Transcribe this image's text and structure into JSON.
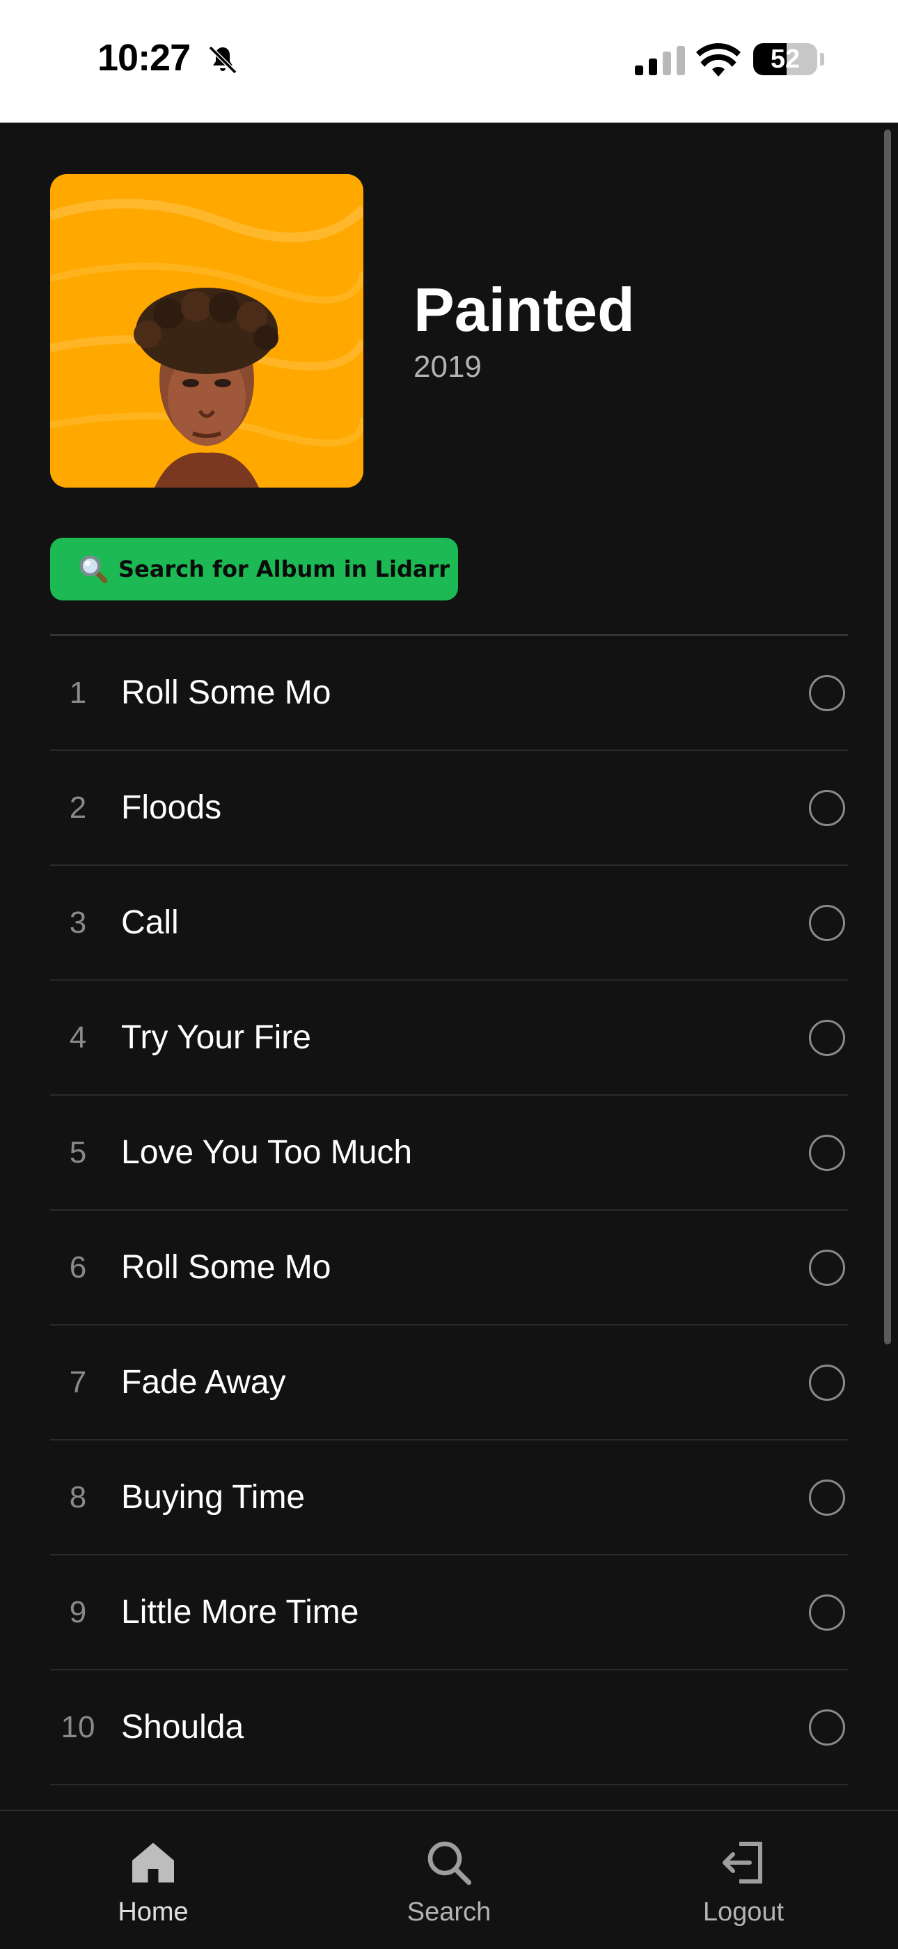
{
  "status_bar": {
    "time": "10:27",
    "battery_percent": 52,
    "battery_label": "52",
    "icons": [
      "bell-slash-icon",
      "cellular-signal-icon",
      "wifi-icon",
      "battery-icon"
    ]
  },
  "album": {
    "title": "Painted",
    "year": "2019",
    "cover_color": "#ffa800"
  },
  "lidarr_button": {
    "icon": "magnifying-glass-icon",
    "label": "Search for Album in Lidarr",
    "color": "#1db954"
  },
  "tracks": [
    {
      "number": "1",
      "name": "Roll Some Mo"
    },
    {
      "number": "2",
      "name": "Floods"
    },
    {
      "number": "3",
      "name": "Call"
    },
    {
      "number": "4",
      "name": "Try Your Fire"
    },
    {
      "number": "5",
      "name": "Love You Too Much"
    },
    {
      "number": "6",
      "name": "Roll Some Mo"
    },
    {
      "number": "7",
      "name": "Fade Away"
    },
    {
      "number": "8",
      "name": "Buying Time"
    },
    {
      "number": "9",
      "name": "Little More Time"
    },
    {
      "number": "10",
      "name": "Shoulda"
    }
  ],
  "tab_bar": {
    "items": [
      {
        "label": "Home",
        "icon": "home-icon"
      },
      {
        "label": "Search",
        "icon": "search-icon"
      },
      {
        "label": "Logout",
        "icon": "logout-icon"
      }
    ]
  },
  "colors": {
    "background": "#121212",
    "accent": "#1db954"
  }
}
